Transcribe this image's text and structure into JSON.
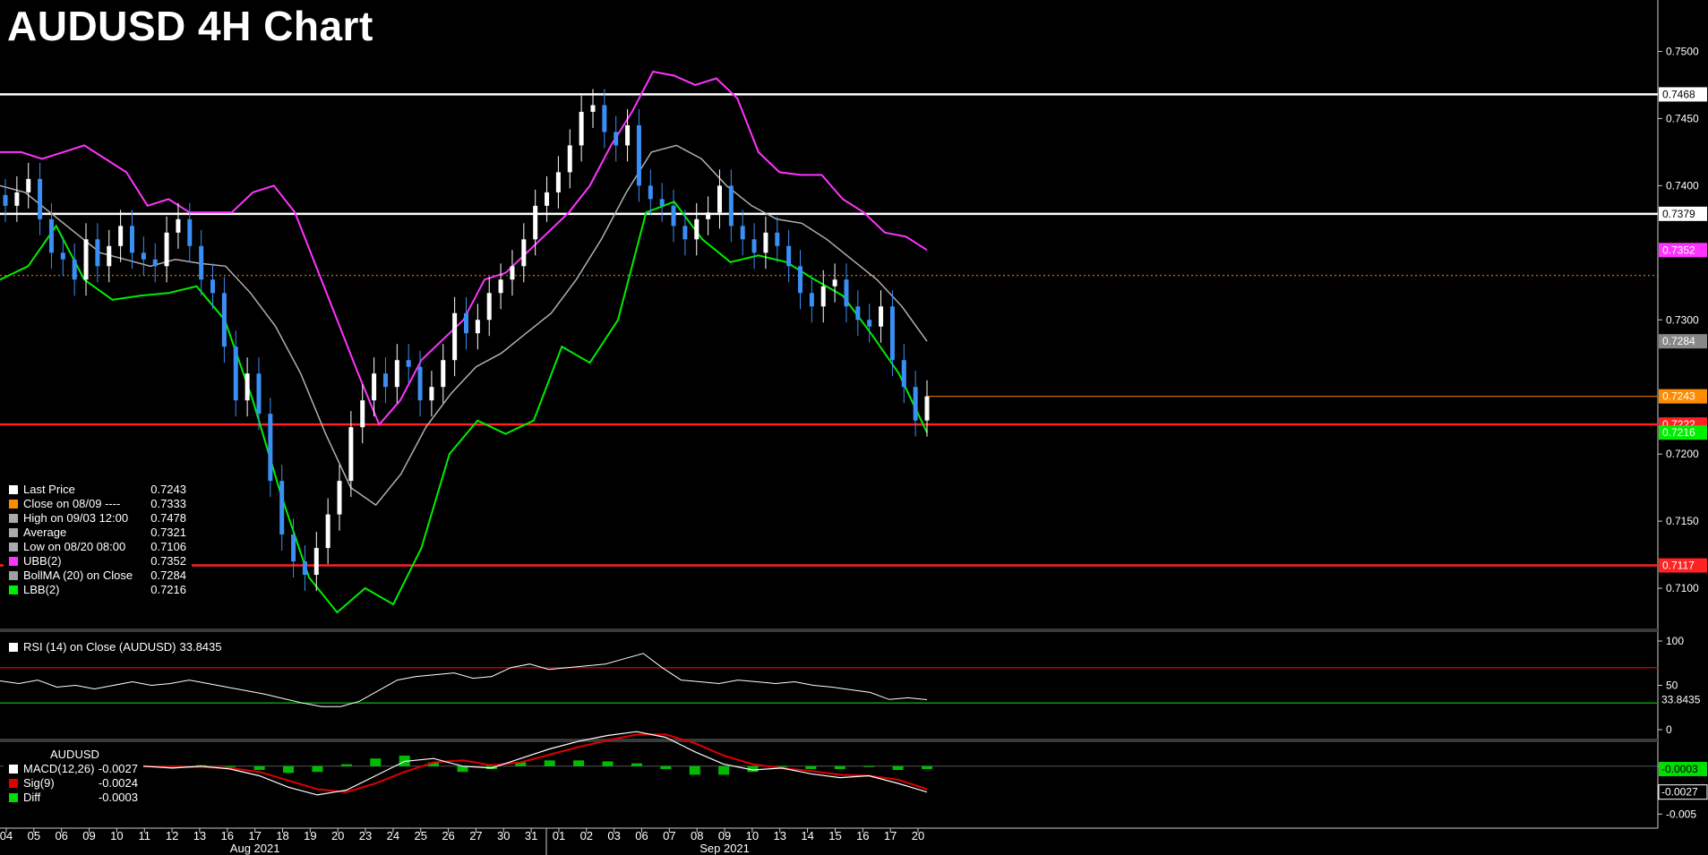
{
  "title": "AUDUSD 4H Chart",
  "colors": {
    "background": "#000000",
    "up_candle": "#ffffff",
    "down_candle": "#3a8ff5",
    "ubb": "#ff33ff",
    "lbb": "#00ee00",
    "boll_ma": "#b0b0b0",
    "support_lines": "#ff2222",
    "resistance_lines": "#ffffff",
    "close_line": "#ff8c00",
    "rsi_upper": "#c00000",
    "rsi_lower": "#00a000",
    "macd": "#ffffff",
    "sig": "#dd0000",
    "diff": "#00dd00"
  },
  "legend_main": [
    {
      "label": "Last Price",
      "value": "0.7243",
      "color": "#ffffff",
      "icon": "square"
    },
    {
      "label": "Close on 08/09 ----",
      "value": "0.7333",
      "color": "#ff8c00",
      "icon": "square"
    },
    {
      "label": "High on 09/03 12:00",
      "value": "0.7478",
      "color": "#aaaaaa",
      "icon": "high-marker"
    },
    {
      "label": "Average",
      "value": "0.7321",
      "color": "#aaaaaa",
      "icon": "average-marker"
    },
    {
      "label": "Low on 08/20 08:00",
      "value": "0.7106",
      "color": "#aaaaaa",
      "icon": "low-marker"
    },
    {
      "label": "UBB(2)",
      "value": "0.7352",
      "color": "#ff33ff",
      "icon": "square"
    },
    {
      "label": "BollMA (20)  on Close",
      "value": "0.7284",
      "color": "#a0a0a0",
      "icon": "square"
    },
    {
      "label": "LBB(2)",
      "value": "0.7216",
      "color": "#00ee00",
      "icon": "square"
    }
  ],
  "legend_rsi": {
    "label": "RSI (14)  on Close (AUDUSD)",
    "value": "33.8435",
    "color": "#ffffff"
  },
  "legend_macd": {
    "title": "AUDUSD",
    "rows": [
      {
        "label": "MACD(12,26)",
        "value": "-0.0027",
        "color": "#ffffff"
      },
      {
        "label": "Sig(9)",
        "value": "-0.0024",
        "color": "#dd0000"
      },
      {
        "label": "Diff",
        "value": "-0.0003",
        "color": "#00dd00"
      }
    ]
  },
  "chart_data": [
    {
      "type": "candlestick",
      "title": "AUDUSD 4H Chart",
      "y_ticks": [
        "0.7500",
        "0.7450",
        "0.7400",
        "0.7300",
        "0.7200",
        "0.7150",
        "0.7100"
      ],
      "ylim": [
        0.707,
        0.7525
      ],
      "x_ticks": [
        "04",
        "05",
        "06",
        "09",
        "10",
        "11",
        "12",
        "13",
        "16",
        "17",
        "18",
        "19",
        "20",
        "23",
        "24",
        "25",
        "26",
        "27",
        "30",
        "31",
        "01",
        "02",
        "03",
        "06",
        "07",
        "08",
        "09",
        "10",
        "13",
        "14",
        "15",
        "16",
        "17",
        "20"
      ],
      "x_period_labels": [
        {
          "label": "Aug 2021",
          "at": "17"
        },
        {
          "label": "Sep 2021",
          "at": "09"
        }
      ],
      "close_series": [
        0.7385,
        0.7395,
        0.7405,
        0.7375,
        0.735,
        0.7345,
        0.733,
        0.736,
        0.734,
        0.7355,
        0.737,
        0.735,
        0.7345,
        0.734,
        0.7365,
        0.7375,
        0.7355,
        0.733,
        0.732,
        0.728,
        0.724,
        0.726,
        0.723,
        0.718,
        0.714,
        0.712,
        0.711,
        0.713,
        0.7155,
        0.718,
        0.722,
        0.724,
        0.726,
        0.725,
        0.727,
        0.7265,
        0.724,
        0.725,
        0.727,
        0.7305,
        0.729,
        0.73,
        0.732,
        0.733,
        0.734,
        0.736,
        0.7385,
        0.7395,
        0.741,
        0.743,
        0.7455,
        0.746,
        0.744,
        0.743,
        0.7445,
        0.74,
        0.739,
        0.7385,
        0.737,
        0.736,
        0.7375,
        0.738,
        0.74,
        0.737,
        0.736,
        0.735,
        0.7365,
        0.7355,
        0.734,
        0.732,
        0.731,
        0.7325,
        0.733,
        0.731,
        0.73,
        0.7295,
        0.731,
        0.727,
        0.725,
        0.7225,
        0.7243
      ],
      "ubb": [
        0.7425,
        0.7425,
        0.742,
        0.7425,
        0.743,
        0.742,
        0.741,
        0.7385,
        0.739,
        0.738,
        0.738,
        0.738,
        0.7395,
        0.74,
        0.738,
        0.734,
        0.73,
        0.726,
        0.7222,
        0.724,
        0.727,
        0.7285,
        0.73,
        0.733,
        0.7335,
        0.735,
        0.7365,
        0.738,
        0.74,
        0.743,
        0.7455,
        0.7485,
        0.7482,
        0.7475,
        0.748,
        0.7465,
        0.7425,
        0.741,
        0.7408,
        0.7408,
        0.739,
        0.738,
        0.7365,
        0.7362,
        0.7352
      ],
      "boll_ma": [
        0.74,
        0.7395,
        0.738,
        0.7365,
        0.735,
        0.7345,
        0.734,
        0.7345,
        0.7342,
        0.734,
        0.732,
        0.7295,
        0.726,
        0.7215,
        0.7175,
        0.7162,
        0.7185,
        0.722,
        0.7245,
        0.7265,
        0.7275,
        0.729,
        0.7305,
        0.733,
        0.736,
        0.7395,
        0.7425,
        0.743,
        0.742,
        0.74,
        0.7385,
        0.7375,
        0.7372,
        0.736,
        0.7345,
        0.733,
        0.731,
        0.7284
      ],
      "lbb": [
        0.733,
        0.734,
        0.737,
        0.733,
        0.7315,
        0.7318,
        0.732,
        0.7325,
        0.73,
        0.724,
        0.717,
        0.7108,
        0.7082,
        0.71,
        0.7088,
        0.713,
        0.72,
        0.7225,
        0.7215,
        0.7225,
        0.728,
        0.7268,
        0.73,
        0.738,
        0.7388,
        0.736,
        0.7343,
        0.7348,
        0.7343,
        0.733,
        0.7318,
        0.729,
        0.726,
        0.7216
      ],
      "horizontal_lines": [
        {
          "value": 0.7468,
          "label": "0.7468",
          "color": "#ffffff"
        },
        {
          "value": 0.7379,
          "label": "0.7379",
          "color": "#ffffff"
        },
        {
          "value": 0.7333,
          "label": "",
          "color": "#ff8c00",
          "dashed": true
        },
        {
          "value": 0.7243,
          "label": "0.7243",
          "color": "#ff8c00"
        },
        {
          "value": 0.7222,
          "label": "0.7222",
          "color": "#ff2222"
        },
        {
          "value": 0.7117,
          "label": "0.7117",
          "color": "#ff2222"
        }
      ],
      "axis_badges": [
        {
          "value": 0.7352,
          "label": "0.7352",
          "color": "#ff33ff"
        },
        {
          "value": 0.7284,
          "label": "0.7284",
          "color": "#888888"
        },
        {
          "value": 0.7216,
          "label": "0.7216",
          "color": "#00ee00"
        }
      ],
      "last_price": 0.7243
    },
    {
      "type": "line",
      "title": "RSI (14)  on Close (AUDUSD)",
      "y_ticks": [
        "100",
        "50",
        "0"
      ],
      "ylim": [
        0,
        100
      ],
      "levels": [
        70,
        30
      ],
      "values": [
        55,
        52,
        56,
        48,
        50,
        46,
        50,
        54,
        50,
        52,
        56,
        52,
        48,
        44,
        40,
        35,
        30,
        26,
        26,
        32,
        44,
        56,
        60,
        62,
        64,
        58,
        60,
        70,
        74,
        68,
        70,
        72,
        74,
        80,
        86,
        70,
        56,
        54,
        52,
        56,
        54,
        52,
        54,
        50,
        48,
        45,
        42,
        34,
        36,
        33.8435
      ],
      "last": "33.8435"
    },
    {
      "type": "line",
      "title": "AUDUSD",
      "y_ticks": [
        "0",
        "-0.005"
      ],
      "ylim": [
        -0.006,
        0.0025
      ],
      "series": [
        {
          "name": "MACD(12,26)",
          "values": [
            0.0,
            -0.0002,
            0.0,
            -0.0003,
            -0.001,
            -0.0022,
            -0.003,
            -0.0025,
            -0.001,
            0.0005,
            0.0008,
            0.0,
            -0.0002,
            0.0008,
            0.0018,
            0.0026,
            0.0032,
            0.0036,
            0.003,
            0.0015,
            0.0002,
            -0.0004,
            -0.0002,
            -0.0008,
            -0.0012,
            -0.001,
            -0.0018,
            -0.0027
          ]
        },
        {
          "name": "Sig(9)",
          "values": [
            0.0,
            -0.0001,
            -0.0001,
            -0.0002,
            -0.0006,
            -0.0015,
            -0.0024,
            -0.0027,
            -0.0018,
            -0.0006,
            0.0004,
            0.0006,
            0.0001,
            0.0004,
            0.0012,
            0.002,
            0.0027,
            0.0033,
            0.0033,
            0.0024,
            0.0011,
            0.0002,
            -0.0002,
            -0.0005,
            -0.0009,
            -0.001,
            -0.0014,
            -0.0024
          ]
        },
        {
          "name": "Diff",
          "values": [
            0.0,
            -0.0001,
            0.0001,
            -0.0001,
            -0.0004,
            -0.0007,
            -0.0006,
            0.0002,
            0.0008,
            0.0011,
            0.0004,
            -0.0006,
            -0.0003,
            0.0004,
            0.0006,
            0.0006,
            0.0005,
            0.0003,
            -0.0003,
            -0.0009,
            -0.0009,
            -0.0006,
            0.0,
            -0.0003,
            -0.0003,
            0.0,
            -0.0004,
            -0.0003
          ]
        }
      ],
      "badges": [
        {
          "value": -0.0003,
          "label": "-0.0003",
          "color": "#00dd00"
        },
        {
          "value": -0.0027,
          "label": "-0.0027",
          "color": "#ffffff"
        }
      ]
    }
  ]
}
